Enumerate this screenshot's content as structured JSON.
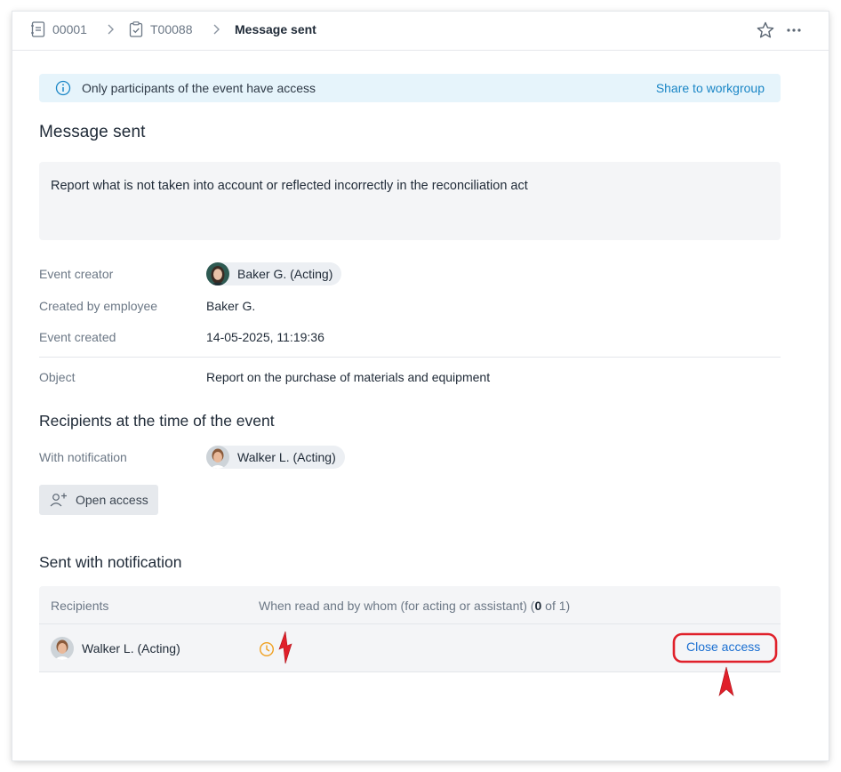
{
  "breadcrumb": {
    "items": [
      {
        "label": "00001",
        "icon": "document-icon"
      },
      {
        "label": "T00088",
        "icon": "task-icon"
      }
    ],
    "current": "Message sent"
  },
  "info_bar": {
    "message": "Only participants of the event have access",
    "action": "Share to workgroup"
  },
  "title": "Message sent",
  "message_text": "Report what is not taken into account or reflected incorrectly in the reconciliation act",
  "details": {
    "creator_label": "Event creator",
    "creator_value": "Baker G. (Acting)",
    "created_by_label": "Created by employee",
    "created_by_value": "Baker G.",
    "created_label": "Event created",
    "created_value": "14-05-2025, 11:19:36",
    "object_label": "Object",
    "object_value": "Report on the purchase of materials and equipment"
  },
  "recipients_section": {
    "heading": "Recipients at the time of the event",
    "notification_label": "With notification",
    "recipient": "Walker L. (Acting)",
    "open_access_label": "Open access"
  },
  "sent_section": {
    "heading": "Sent with notification",
    "col_recipients": "Recipients",
    "col_when_read": "When read and by whom (for acting or assistant) (",
    "read_count": "0",
    "read_total": " of 1)",
    "rows": [
      {
        "name": "Walker L. (Acting)",
        "status_icon": "clock-icon",
        "action": "Close access"
      }
    ]
  },
  "colors": {
    "accent": "#1a86c6",
    "link": "#1a6fd1",
    "annotation": "#e0202a",
    "pending": "#f0a020"
  }
}
